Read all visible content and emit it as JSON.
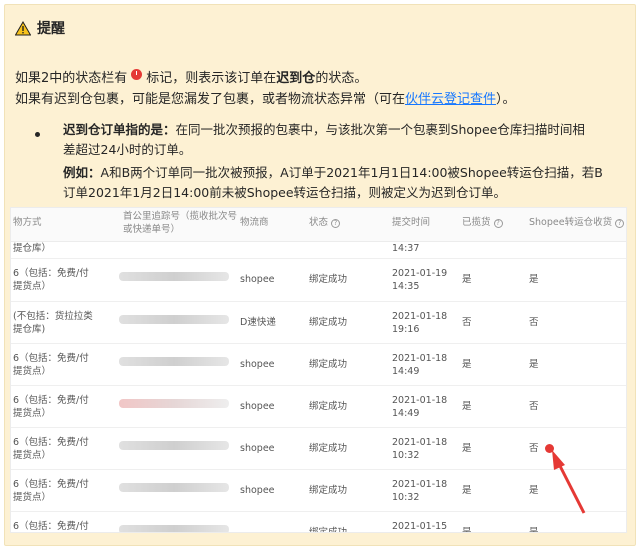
{
  "callout": {
    "title": "提醒",
    "line1_prefix": "如果2中的状态栏有",
    "line1_mid": "标记，则表示该订单在",
    "line1_bold": "迟到仓",
    "line1_suffix": "的状态。",
    "line2_prefix": "如果有迟到仓包裹，可能是您漏发了包裹，或者物流状态异常（可在",
    "line2_link": "伙伴云登记查件",
    "line2_suffix": "）。",
    "bullet_label": "迟到仓订单指的是：",
    "bullet_text_1": "在同一批次预报的包裹中，与该批次第一个包裹到Shopee仓库扫描时间相",
    "bullet_text_2": "差超过24小时的订单。",
    "example_label": "例如：",
    "example_text_1": "A和B两个订单同一批次被预报，A订单于2021年1月1日14:00被Shopee转运仓扫描，若B",
    "example_text_2": "订单2021年1月2日14:00前未被Shopee转运仓扫描，则被定义为迟到仓订单。"
  },
  "table": {
    "headers": {
      "method": "物方式",
      "tracking_1": "首公里追踪号（揽收批次号",
      "tracking_2": "或快递单号）",
      "carrier": "物流商",
      "status": "状态",
      "submit_time": "提交时间",
      "picked": "已揽货",
      "shopee_received": "Shopee转运仓收货"
    },
    "top_partial": {
      "method": "提仓库）",
      "time": "14:37"
    },
    "rows": [
      {
        "method_1": "6（包括：免费/付",
        "method_2": "提货点）",
        "carrier": "shopee",
        "status": "绑定成功",
        "date": "2021-01-19",
        "time": "14:35",
        "picked": "是",
        "received": "是",
        "flag": false,
        "blur_red": false
      },
      {
        "method_1": "(不包括：货拉拉类",
        "method_2": "提仓库)",
        "carrier": "D速快递",
        "status": "绑定成功",
        "date": "2021-01-18",
        "time": "19:16",
        "picked": "否",
        "received": "否",
        "flag": false,
        "blur_red": false
      },
      {
        "method_1": "6（包括：免费/付",
        "method_2": "提货点）",
        "carrier": "shopee",
        "status": "绑定成功",
        "date": "2021-01-18",
        "time": "14:49",
        "picked": "是",
        "received": "是",
        "flag": false,
        "blur_red": false
      },
      {
        "method_1": "6（包括：免费/付",
        "method_2": "提货点）",
        "carrier": "shopee",
        "status": "绑定成功",
        "date": "2021-01-18",
        "time": "14:49",
        "picked": "是",
        "received": "否",
        "flag": false,
        "blur_red": true
      },
      {
        "method_1": "6（包括：免费/付",
        "method_2": "提货点）",
        "carrier": "shopee",
        "status": "绑定成功",
        "date": "2021-01-18",
        "time": "10:32",
        "picked": "是",
        "received": "否",
        "flag": true,
        "blur_red": false
      },
      {
        "method_1": "6（包括：免费/付",
        "method_2": "提货点）",
        "carrier": "shopee",
        "status": "绑定成功",
        "date": "2021-01-18",
        "time": "10:32",
        "picked": "是",
        "received": "是",
        "flag": false,
        "blur_red": false
      },
      {
        "method_1": "6（包括：免费/付",
        "method_2": "",
        "carrier": "",
        "status": "绑定成功",
        "date": "2021-01-15",
        "time": "",
        "picked": "是",
        "received": "是",
        "flag": false,
        "blur_red": false
      }
    ]
  },
  "colors": {
    "callout_bg": "#fdf1d3",
    "link": "#1677ff",
    "flag": "#e53935"
  },
  "icons": {
    "warning": "warning-triangle-icon",
    "flag": "red-exclamation-dot-icon",
    "help": "question-circle-icon"
  }
}
